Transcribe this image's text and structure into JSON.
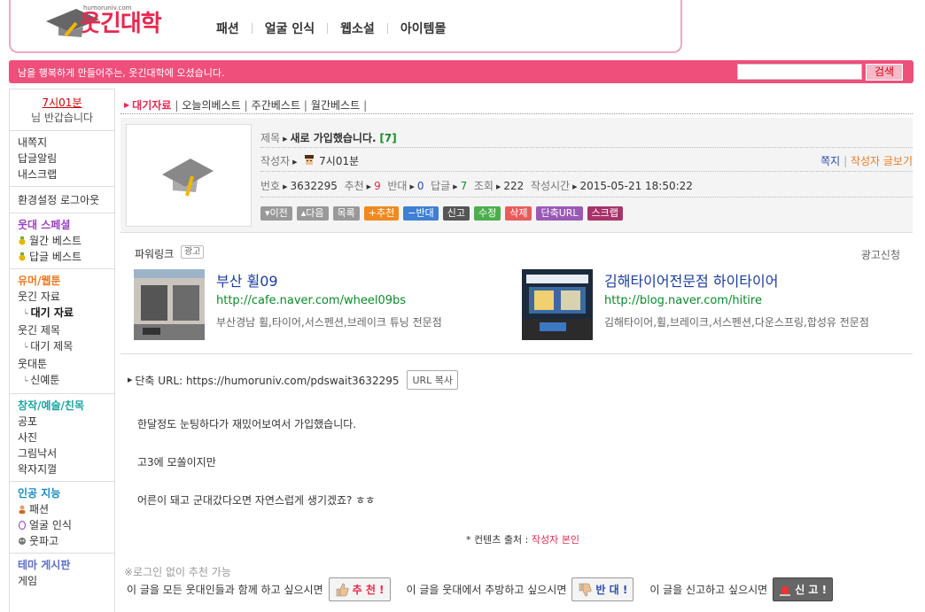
{
  "header": {
    "logo_text": "웃긴대학",
    "logo_url_text": "humoruniv.com",
    "nav": [
      "패션",
      "얼굴 인식",
      "웹소설",
      "아이템몰"
    ]
  },
  "topbar": {
    "welcome": "남을 행복하게 만들어주는, 웃긴대학에 오셨습니다.",
    "search_placeholder": "",
    "search_button": "검색"
  },
  "sidebar": {
    "nickname": "7시01분",
    "greeting": "님 반갑습니다",
    "user_links": [
      "내쪽지",
      "답글알림",
      "내스크랩"
    ],
    "settings": "환경설정",
    "logout": "로그아웃",
    "special": {
      "title": "웃대 스페셜",
      "items": [
        "월간 베스트",
        "답글 베스트"
      ]
    },
    "humor": {
      "title": "유머/웹툰",
      "items": [
        {
          "label": "웃긴 자료",
          "sub": false,
          "bold": false
        },
        {
          "label": "대기 자료",
          "sub": true,
          "bold": true
        },
        {
          "label": "웃긴 제목",
          "sub": false,
          "bold": false
        },
        {
          "label": "대기 제목",
          "sub": true,
          "bold": false
        },
        {
          "label": "웃대툰",
          "sub": false,
          "bold": false
        },
        {
          "label": "신예툰",
          "sub": true,
          "bold": false
        }
      ]
    },
    "creative": {
      "title": "창작/예술/친목",
      "items": [
        "공포",
        "사진",
        "그림낙서",
        "왁자지껄"
      ]
    },
    "ai": {
      "title": "인공 지능",
      "items": [
        "패션",
        "얼굴 인식",
        "웃파고"
      ]
    },
    "theme": {
      "title": "테마 게시판",
      "items": [
        "게임"
      ]
    }
  },
  "tabs": [
    "대기자료",
    "오늘의베스트",
    "주간베스트",
    "월간베스트"
  ],
  "post": {
    "subject_label": "제목",
    "subject": "새로 가입했습니다.",
    "comment_count": "[7]",
    "author_label": "작성자",
    "author": "7시01분",
    "message_link": "쪽지",
    "author_posts_link": "작성자 글보기",
    "no_label": "번호",
    "no": "3632295",
    "reco_label": "추천",
    "reco": "9",
    "oppose_label": "반대",
    "oppose": "0",
    "reply_label": "답글",
    "reply": "7",
    "view_label": "조회",
    "view": "222",
    "time_label": "작성시간",
    "time": "2015-05-21 18:50:22",
    "buttons": [
      {
        "label": "▾이전",
        "color": "#999999"
      },
      {
        "label": "▴다음",
        "color": "#999999"
      },
      {
        "label": "목록",
        "color": "#999999"
      },
      {
        "label": "+추천",
        "color": "#f08a1e"
      },
      {
        "label": "−반대",
        "color": "#3f7fd4"
      },
      {
        "label": "신고",
        "color": "#555555"
      },
      {
        "label": "수정",
        "color": "#4cae4c"
      },
      {
        "label": "삭제",
        "color": "#e85c5c"
      },
      {
        "label": "단축URL",
        "color": "#9b59b6"
      },
      {
        "label": "스크랩",
        "color": "#a8336a"
      }
    ]
  },
  "powerlink": {
    "title": "파워링크",
    "ad_badge": "광고",
    "apply": "광고신청",
    "ads": [
      {
        "title": "부산 휠09",
        "url": "http://cafe.naver.com/wheel09bs",
        "desc": "부산경남 휠,타이어,서스펜션,브레이크 튜닝 전문점"
      },
      {
        "title": "김해타이어전문점 하이타이어",
        "url": "http://blog.naver.com/hitire",
        "desc": "김해타이어,휠,브레이크,서스펜션,다운스프링,합성유 전문점"
      }
    ]
  },
  "content": {
    "short_url_label": "단축 URL: https://humoruniv.com/pdswait3632295",
    "url_copy": "URL 복사",
    "lines": [
      "한달정도 눈팅하다가 재밌어보여서 가입했습니다.",
      "고3에 모쏠이지만",
      "어른이 돼고 군대갔다오면 자연스럽게 생기겠죠? ㅎㅎ"
    ],
    "source_prefix": "* 컨텐츠 출처 :",
    "source_who": "작성자 본인",
    "no_login_reco": "※로그인 없이 추천 가능",
    "reco_text": "이 글을 모든 웃대인들과 함께 하고 싶으시면",
    "reco_btn": "추 천 !",
    "oppose_text": "이 글을 웃대에서 추방하고 싶으시면",
    "oppose_btn": "반 대 !",
    "report_text": "이 글을 신고하고 싶으시면",
    "report_btn": "신 고 !"
  }
}
